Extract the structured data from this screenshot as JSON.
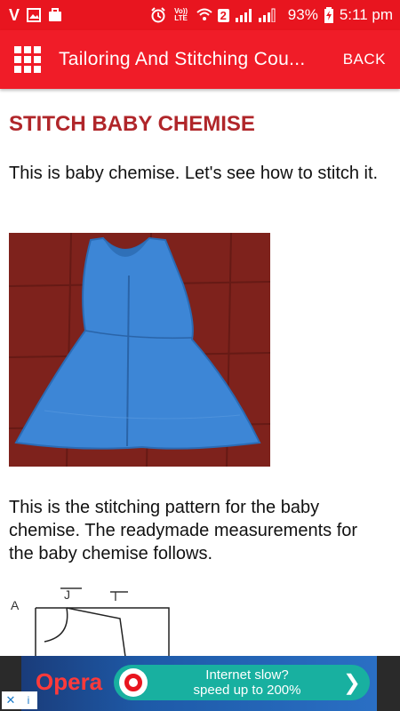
{
  "status_bar": {
    "carrier_icon": "V",
    "volte": "Vo)) LTE",
    "sim_badge": "2",
    "battery": "93%",
    "time": "5:11 pm"
  },
  "app_bar": {
    "menu_icon": "grid-icon",
    "title": "Tailoring And Stitching Cou...",
    "back_label": "BACK"
  },
  "article": {
    "heading": "STITCH BABY CHEMISE",
    "intro": "This is baby chemise. Let's see how to stitch it.",
    "pattern_text": "This is the stitching pattern for the baby chemise. The readymade measurements for the baby chemise follows.",
    "pattern_labels": [
      "A",
      "J",
      "I"
    ]
  },
  "ad": {
    "brand": "Opera",
    "line1": "Internet slow?",
    "line2": "speed up to 200%",
    "close": "✕",
    "info": "i"
  },
  "colors": {
    "status_bar": "#e8151f",
    "app_bar": "#f01c28",
    "heading": "#b0262a"
  }
}
